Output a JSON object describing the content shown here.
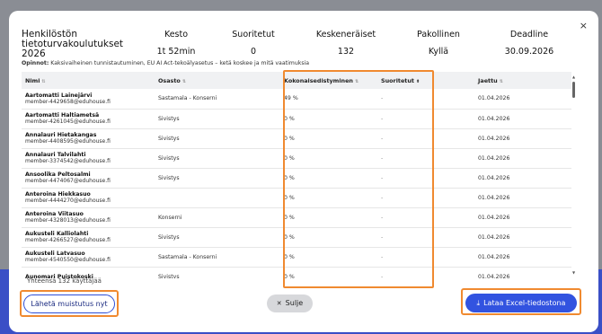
{
  "course": {
    "title": "Henkilöstön tietoturvakoulutukset 2026",
    "stats": [
      {
        "label": "Kesto",
        "value": "1t 52min"
      },
      {
        "label": "Suoritetut",
        "value": "0"
      },
      {
        "label": "Keskeneräiset",
        "value": "132"
      },
      {
        "label": "Pakollinen",
        "value": "Kyllä"
      },
      {
        "label": "Deadline",
        "value": "30.09.2026"
      }
    ],
    "opinnot_label": "Opinnot:",
    "opinnot_value": "Kaksivaiheinen tunnistautuminen, EU AI Act-tekoälyasetus – ketä koskee ja mitä vaatimuksia"
  },
  "table": {
    "headers": {
      "name": "Nimi",
      "department": "Osasto",
      "progress": "Kokonaisedistyminen",
      "completed": "Suoritetut",
      "shared": "Jaettu"
    },
    "rows": [
      {
        "name": "Aartomatti Lainejärvi",
        "email": "member-4429658@eduhouse.fi",
        "department": "Sastamala - Konserni",
        "progress": "49 %",
        "completed": "-",
        "shared": "01.04.2026"
      },
      {
        "name": "Aartomatti Haltiametsä",
        "email": "member-4261045@eduhouse.fi",
        "department": "Sivistys",
        "progress": "0 %",
        "completed": "-",
        "shared": "01.04.2026"
      },
      {
        "name": "Annalauri Hietakangas",
        "email": "member-4408595@eduhouse.fi",
        "department": "Sivistys",
        "progress": "0 %",
        "completed": "-",
        "shared": "01.04.2026"
      },
      {
        "name": "Annalauri Talvilahti",
        "email": "member-3374542@eduhouse.fi",
        "department": "Sivistys",
        "progress": "0 %",
        "completed": "-",
        "shared": "01.04.2026"
      },
      {
        "name": "Ansoolika Peltosalmi",
        "email": "member-4474067@eduhouse.fi",
        "department": "Sivistys",
        "progress": "0 %",
        "completed": "-",
        "shared": "01.04.2026"
      },
      {
        "name": "Anteroina Hiekkasuo",
        "email": "member-4444270@eduhouse.fi",
        "department": "",
        "progress": "0 %",
        "completed": "-",
        "shared": "01.04.2026"
      },
      {
        "name": "Anteroina Viitasuo",
        "email": "member-4328013@eduhouse.fi",
        "department": "Konserni",
        "progress": "0 %",
        "completed": "-",
        "shared": "01.04.2026"
      },
      {
        "name": "Aukusteli Kalliolahti",
        "email": "member-4266527@eduhouse.fi",
        "department": "Sivistys",
        "progress": "0 %",
        "completed": "-",
        "shared": "01.04.2026"
      },
      {
        "name": "Aukusteli Latvasuo",
        "email": "member-4540550@eduhouse.fi",
        "department": "Sastamala - Konserni",
        "progress": "0 %",
        "completed": "-",
        "shared": "01.04.2026"
      },
      {
        "name": "Aunomari Puistokoski",
        "email": "",
        "department": "Sivistys",
        "progress": "0 %",
        "completed": "-",
        "shared": "01.04.2026"
      }
    ]
  },
  "footer": {
    "total": "Yhteensä 132 käyttäjää",
    "reminder_button": "Lähetä muistutus nyt",
    "close_button": "Sulje",
    "excel_button": "Lataa Excel-tiedostona"
  },
  "colors": {
    "accent": "#3253e0",
    "highlight": "#f08a30"
  }
}
